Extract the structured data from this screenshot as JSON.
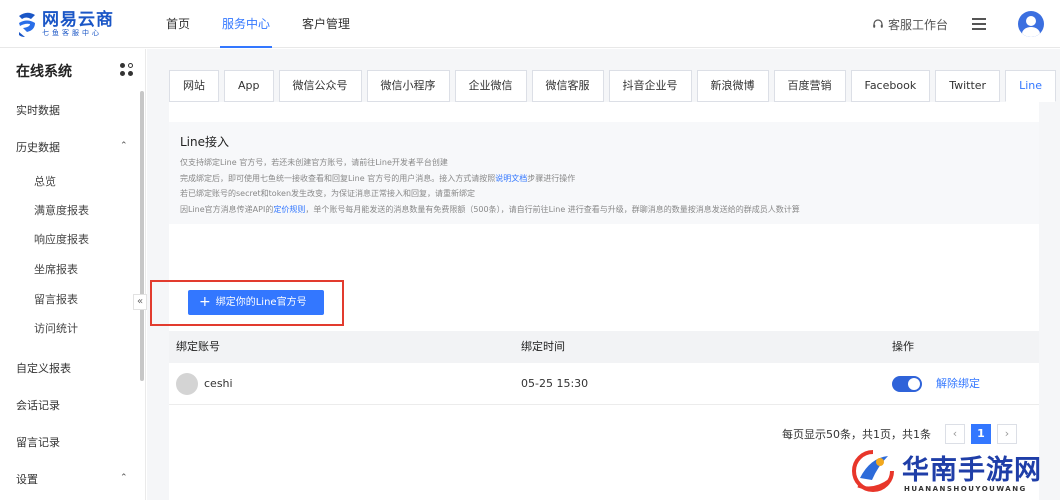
{
  "brand": {
    "name": "网易云商",
    "subtitle": "七鱼客服中心"
  },
  "nav": {
    "items": [
      "首页",
      "服务中心",
      "客户管理"
    ],
    "active_index": 1
  },
  "header": {
    "workbench_label": "客服工作台"
  },
  "sidebar": {
    "title": "在线系统",
    "items": {
      "realtime": "实时数据",
      "history": "历史数据",
      "overview": "总览",
      "satisfaction": "满意度报表",
      "response": "响应度报表",
      "seat": "坐席报表",
      "message": "留言报表",
      "visit": "访问统计",
      "custom": "自定义报表",
      "session": "会话记录",
      "msg_record": "留言记录",
      "settings": "设置"
    },
    "collapse_glyph": "«"
  },
  "tabs": [
    "网站",
    "App",
    "微信公众号",
    "微信小程序",
    "企业微信",
    "微信客服",
    "抖音企业号",
    "新浪微博",
    "百度营销",
    "Facebook",
    "Twitter",
    "Line"
  ],
  "active_tab": "Line",
  "info": {
    "title": "Line接入",
    "line1": "仅支持绑定Line 官方号，若还未创建官方账号，请前往Line开发者平台创建",
    "line2_a": "完成绑定后，即可使用七鱼统一接收查看和回复Line 官方号的用户消息。接入方式请按照",
    "line2_link": "说明文档",
    "line2_b": "步骤进行操作",
    "line3": "若已绑定账号的secret和token发生改变，为保证消息正常接入和回复，请重新绑定",
    "line4_a": "因Line官方消息传递API的",
    "line4_link": "定价规则",
    "line4_b": "，单个账号每月能发送的消息数量有免费限额（500条），请自行前往Line 进行查看与升级，群聊消息的数量按消息发送给的群成员人数计算"
  },
  "bind_button": {
    "plus": "+",
    "label": "绑定你的Line官方号"
  },
  "table": {
    "headers": {
      "account": "绑定账号",
      "time": "绑定时间",
      "action": "操作"
    },
    "rows": [
      {
        "account": "ceshi",
        "time": "05-25 15:30",
        "enabled": true,
        "unbind_label": "解除绑定"
      }
    ]
  },
  "pager": {
    "summary": "每页显示50条，共1页，共1条",
    "prev": "‹",
    "current": "1",
    "next": "›"
  },
  "watermark": {
    "text": "华南手游网",
    "sub": "HUANANSHOUYOUWANG"
  },
  "colors": {
    "accent": "#3377ff",
    "highlight_box": "#e23b2e",
    "brand": "#1a56c6"
  }
}
